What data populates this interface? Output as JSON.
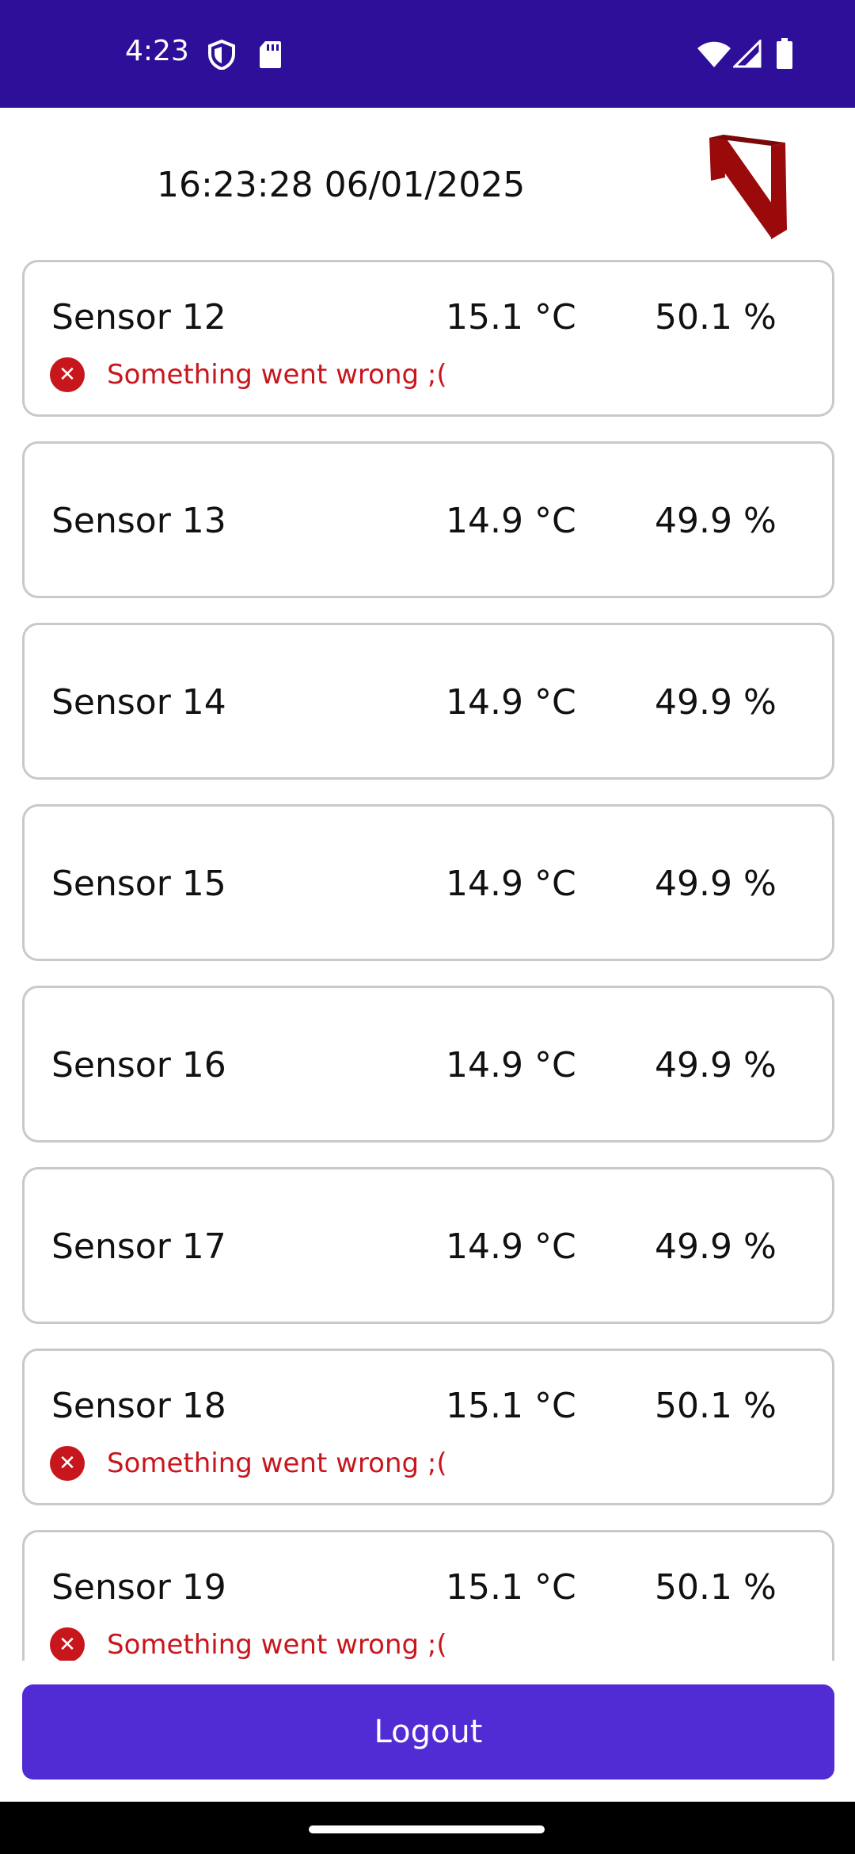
{
  "status_bar": {
    "time": "4:23",
    "icons": [
      "shield-icon",
      "sd-card-icon",
      "wifi-icon",
      "signal-icon",
      "battery-icon"
    ],
    "background": "#2e0f99"
  },
  "header": {
    "datetime": "16:23:28 06/01/2025",
    "logo": "n-logo-icon",
    "logo_color": "#9b0a0a"
  },
  "sensors": [
    {
      "name": "Sensor 12",
      "temperature": "15.1 °C",
      "humidity": "50.1 %",
      "error": "Something went wrong ;("
    },
    {
      "name": "Sensor 13",
      "temperature": "14.9 °C",
      "humidity": "49.9 %",
      "error": null
    },
    {
      "name": "Sensor 14",
      "temperature": "14.9 °C",
      "humidity": "49.9 %",
      "error": null
    },
    {
      "name": "Sensor 15",
      "temperature": "14.9 °C",
      "humidity": "49.9 %",
      "error": null
    },
    {
      "name": "Sensor 16",
      "temperature": "14.9 °C",
      "humidity": "49.9 %",
      "error": null
    },
    {
      "name": "Sensor 17",
      "temperature": "14.9 °C",
      "humidity": "49.9 %",
      "error": null
    },
    {
      "name": "Sensor 18",
      "temperature": "15.1 °C",
      "humidity": "50.1 %",
      "error": "Something went wrong ;("
    },
    {
      "name": "Sensor 19",
      "temperature": "15.1 °C",
      "humidity": "50.1 %",
      "error": "Something went wrong ;("
    }
  ],
  "error_icon": "close-circle-icon",
  "error_color": "#c8161d",
  "footer": {
    "logout_label": "Logout",
    "button_color": "#512bd4"
  }
}
